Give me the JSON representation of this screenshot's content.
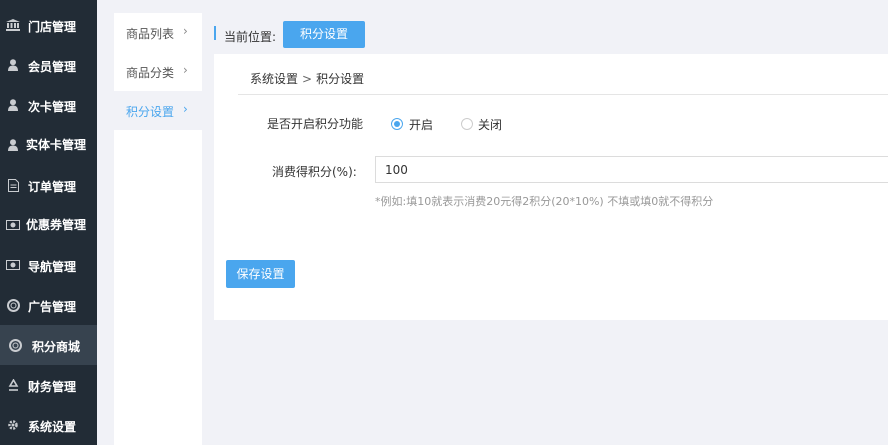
{
  "sidebar": {
    "items": [
      {
        "label": "门店管理",
        "icon": "bank-icon"
      },
      {
        "label": "会员管理",
        "icon": "user-icon"
      },
      {
        "label": "次卡管理",
        "icon": "user-icon"
      },
      {
        "label": "实体卡管理",
        "icon": "user-icon"
      },
      {
        "label": "订单管理",
        "icon": "document-icon"
      },
      {
        "label": "优惠券管理",
        "icon": "money-icon"
      },
      {
        "label": "导航管理",
        "icon": "money-icon"
      },
      {
        "label": "广告管理",
        "icon": "lifebuoy-icon"
      },
      {
        "label": "积分商城",
        "icon": "lifebuoy-icon",
        "active": true
      },
      {
        "label": "财务管理",
        "icon": "recycle-icon"
      },
      {
        "label": "系统设置",
        "icon": "gear-icon"
      }
    ]
  },
  "submenu": {
    "items": [
      {
        "label": "商品列表"
      },
      {
        "label": "商品分类"
      },
      {
        "label": "积分设置",
        "active": true
      }
    ],
    "chevron": "›"
  },
  "breadcrumb": {
    "label": "当前位置:",
    "current": "积分设置"
  },
  "panel": {
    "path_root": "系统设置",
    "path_sep": ">",
    "path_current": "积分设置"
  },
  "form": {
    "enable_label": "是否开启积分功能",
    "radio_on": "开启",
    "radio_off": "关闭",
    "radio_selected": "开启",
    "rate_label": "消费得积分(%):",
    "rate_value": "100",
    "hint": "*例如:填10就表示消费20元得2积分(20*10%) 不填或填0就不得积分",
    "save_label": "保存设置"
  },
  "colors": {
    "accent": "#4aa6ee",
    "sidebar_bg": "#222c36",
    "sidebar_active": "#37434f",
    "page_bg": "#f1f2f7"
  }
}
